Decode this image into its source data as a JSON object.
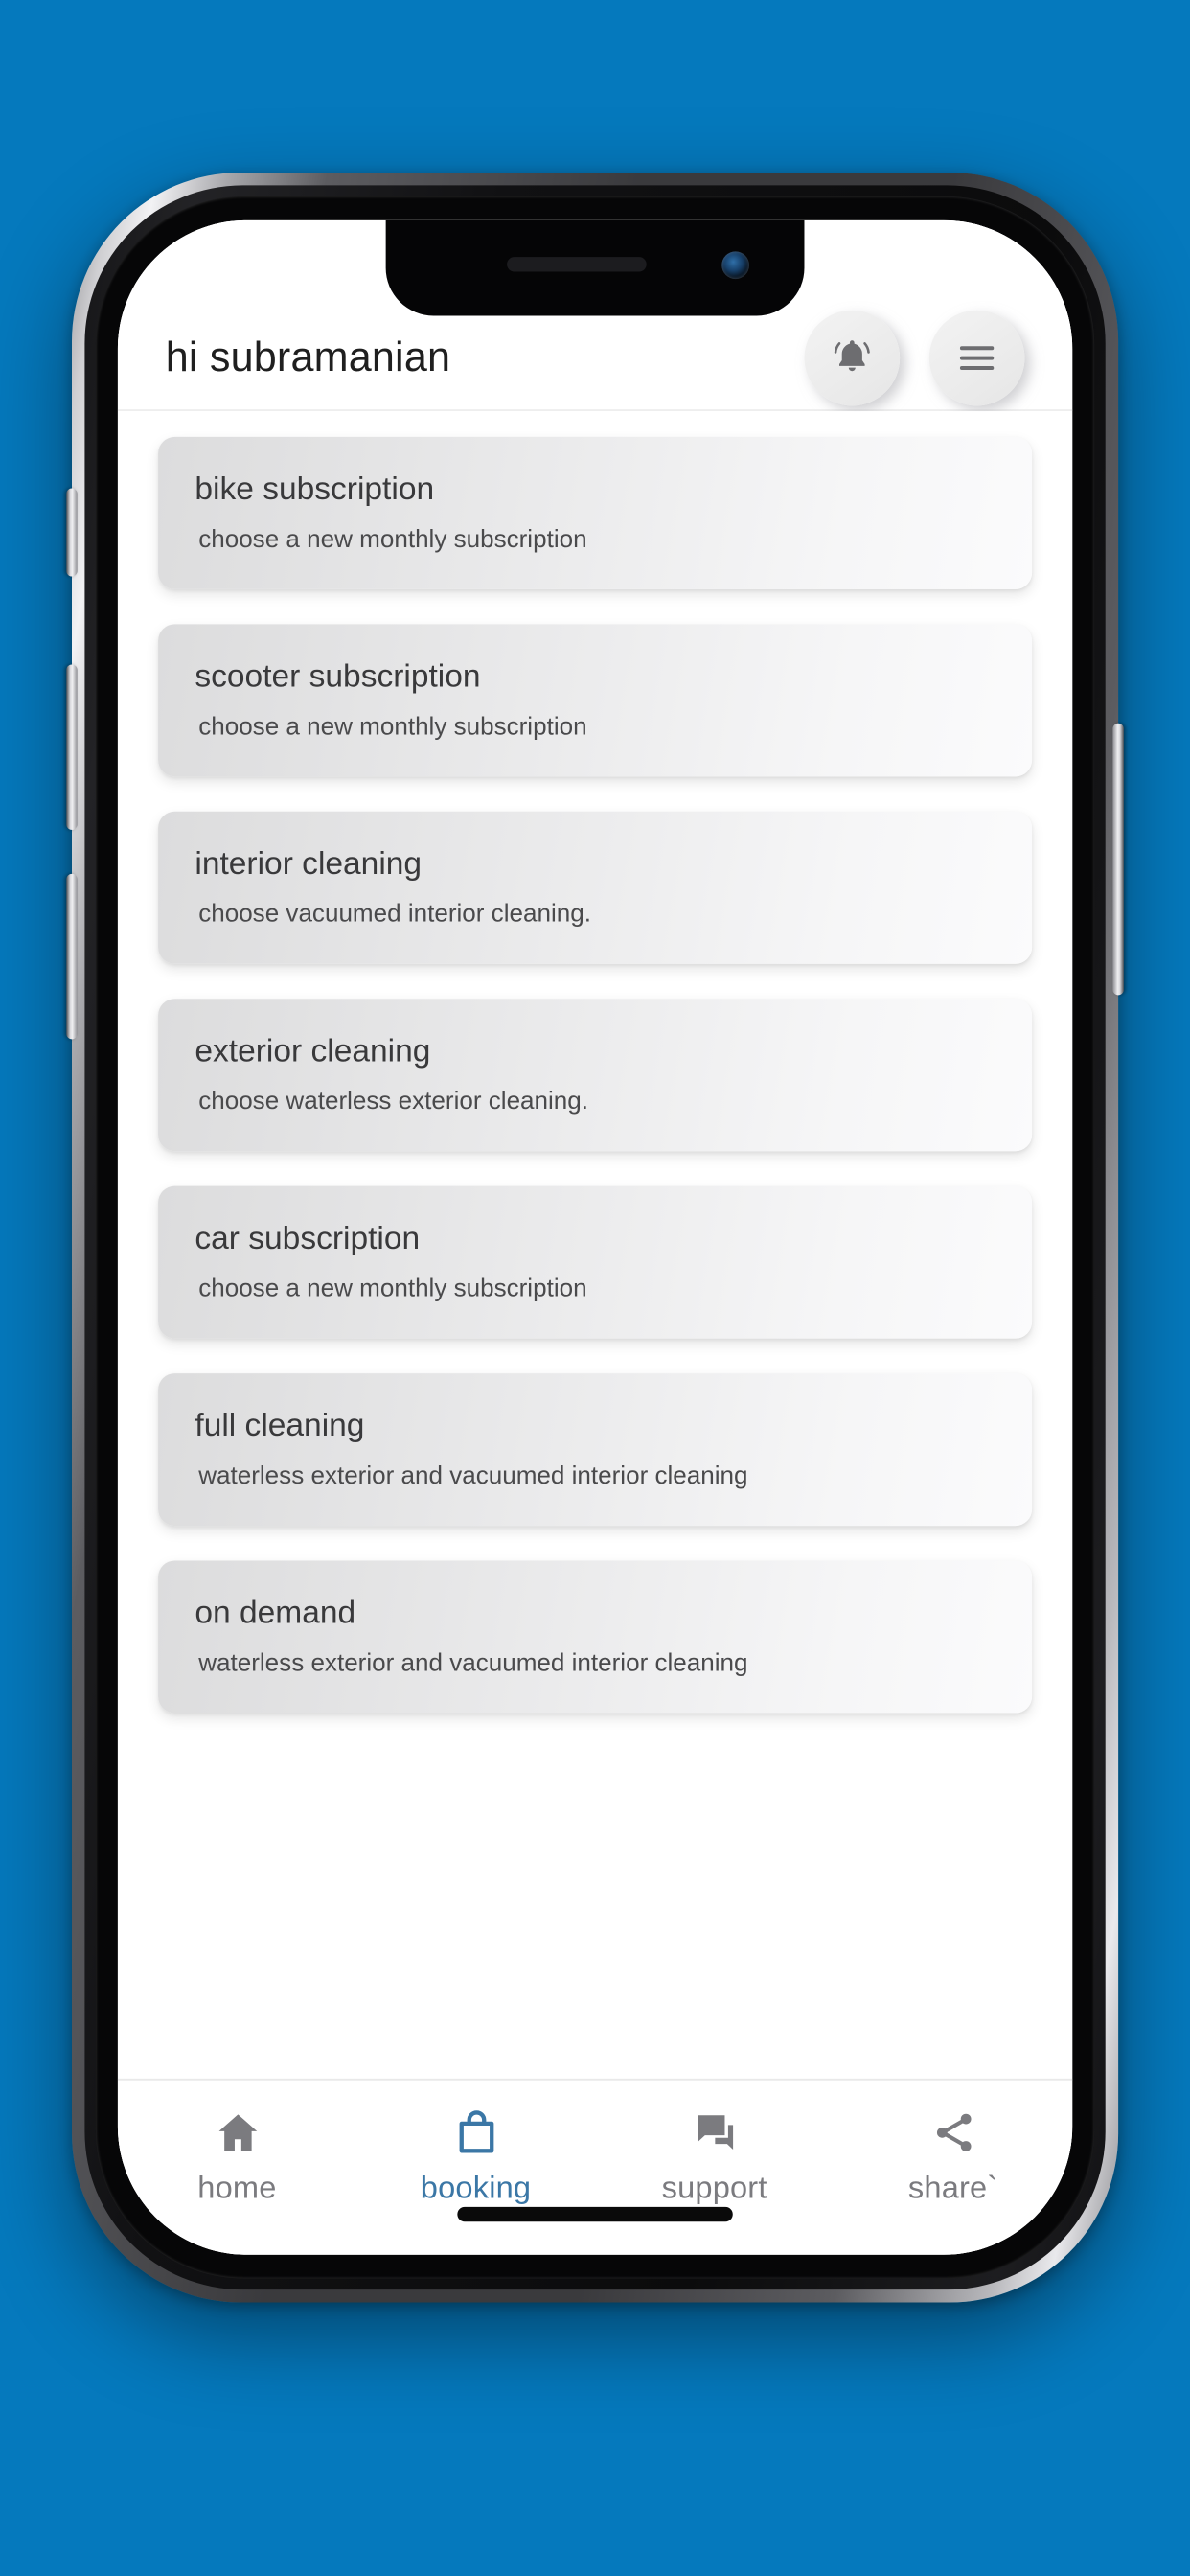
{
  "wallpaper": {
    "color": "#0579bd"
  },
  "device": {
    "type": "smartphone-mockup",
    "notch": {
      "speaker": "earpiece-speaker",
      "camera": "front-camera"
    },
    "buttons": [
      "silent-switch",
      "volume-up",
      "volume-down",
      "power"
    ]
  },
  "app": {
    "header": {
      "greeting": "hi subramanian",
      "notification_icon": "bell-icon",
      "menu_icon": "hamburger-menu-icon"
    },
    "cards": [
      {
        "title": "bike subscription",
        "subtitle": "choose a new monthly subscription"
      },
      {
        "title": "scooter subscription",
        "subtitle": "choose a new monthly subscription"
      },
      {
        "title": "interior cleaning",
        "subtitle": "choose vacuumed interior cleaning."
      },
      {
        "title": "exterior cleaning",
        "subtitle": "choose waterless exterior cleaning."
      },
      {
        "title": "car subscription",
        "subtitle": "choose a new monthly subscription"
      },
      {
        "title": "full cleaning",
        "subtitle": "waterless exterior and vacuumed interior cleaning"
      },
      {
        "title": "on demand",
        "subtitle": "waterless exterior and vacuumed interior cleaning"
      }
    ],
    "bottom_nav": {
      "active_color": "#3b77a6",
      "inactive_color": "#7b7b7f",
      "items": [
        {
          "label": "home",
          "icon": "home-icon",
          "active": false
        },
        {
          "label": "booking",
          "icon": "shopping-bag-icon",
          "active": true
        },
        {
          "label": "support",
          "icon": "chat-bubbles-icon",
          "active": false
        },
        {
          "label": "share`",
          "icon": "share-icon",
          "active": false
        }
      ]
    }
  }
}
